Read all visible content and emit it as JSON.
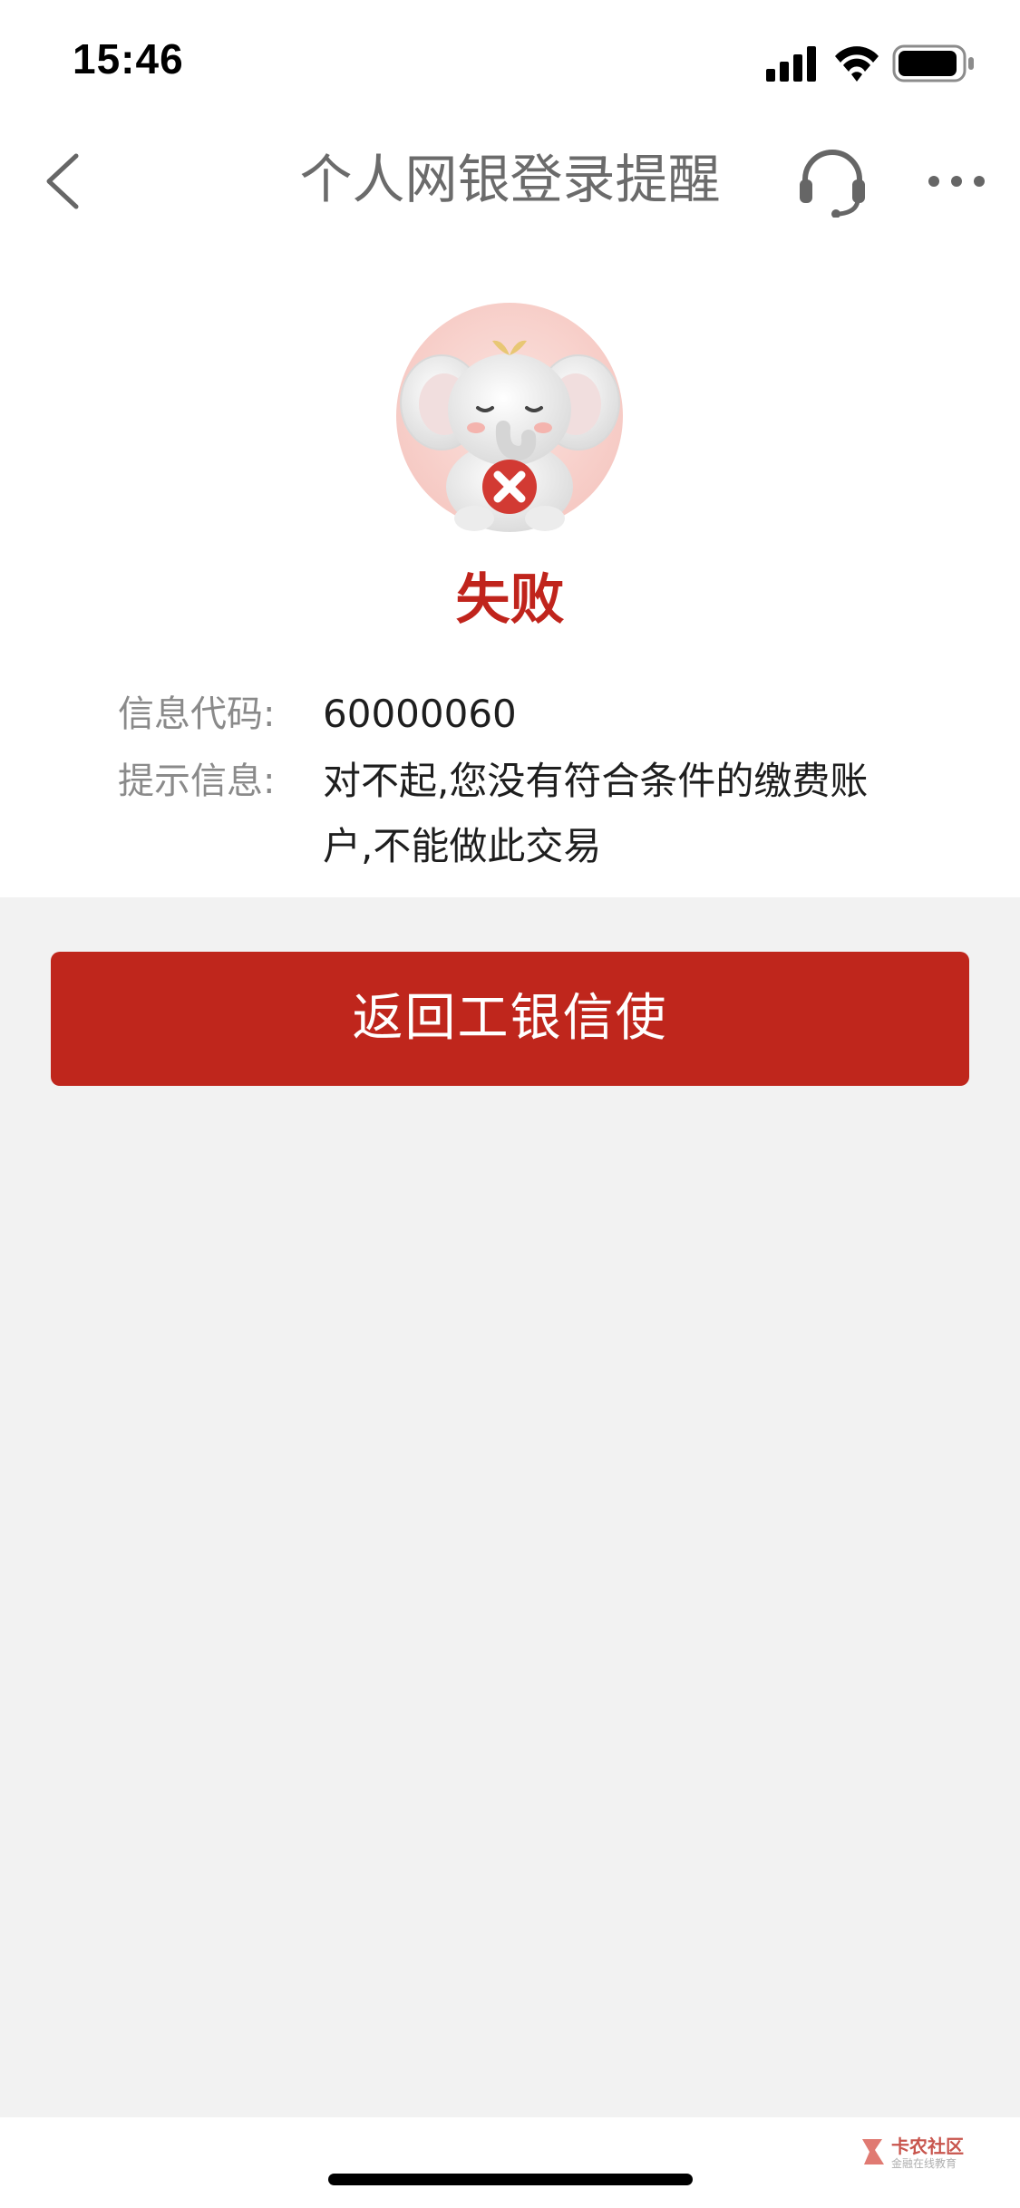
{
  "status_bar": {
    "time": "15:46",
    "icons": [
      "cellular-signal-icon",
      "wifi-icon",
      "battery-icon"
    ]
  },
  "nav": {
    "title": "个人网银登录提醒",
    "back_icon": "chevron-left-icon",
    "headset_icon": "headset-icon",
    "more_icon": "more-icon"
  },
  "result": {
    "mascot": "elephant-mascot-with-error",
    "title": "失败",
    "title_color": "#c0241c"
  },
  "info": {
    "code_label": "信息代码:",
    "code_value": "60000060",
    "message_label": "提示信息:",
    "message_value": "对不起,您没有符合条件的缴费账户,不能做此交易"
  },
  "actions": {
    "return_button": "返回工银信使",
    "button_color": "#bf261c"
  },
  "watermark": {
    "name": "卡农社区",
    "subtitle": "金融在线教育"
  }
}
